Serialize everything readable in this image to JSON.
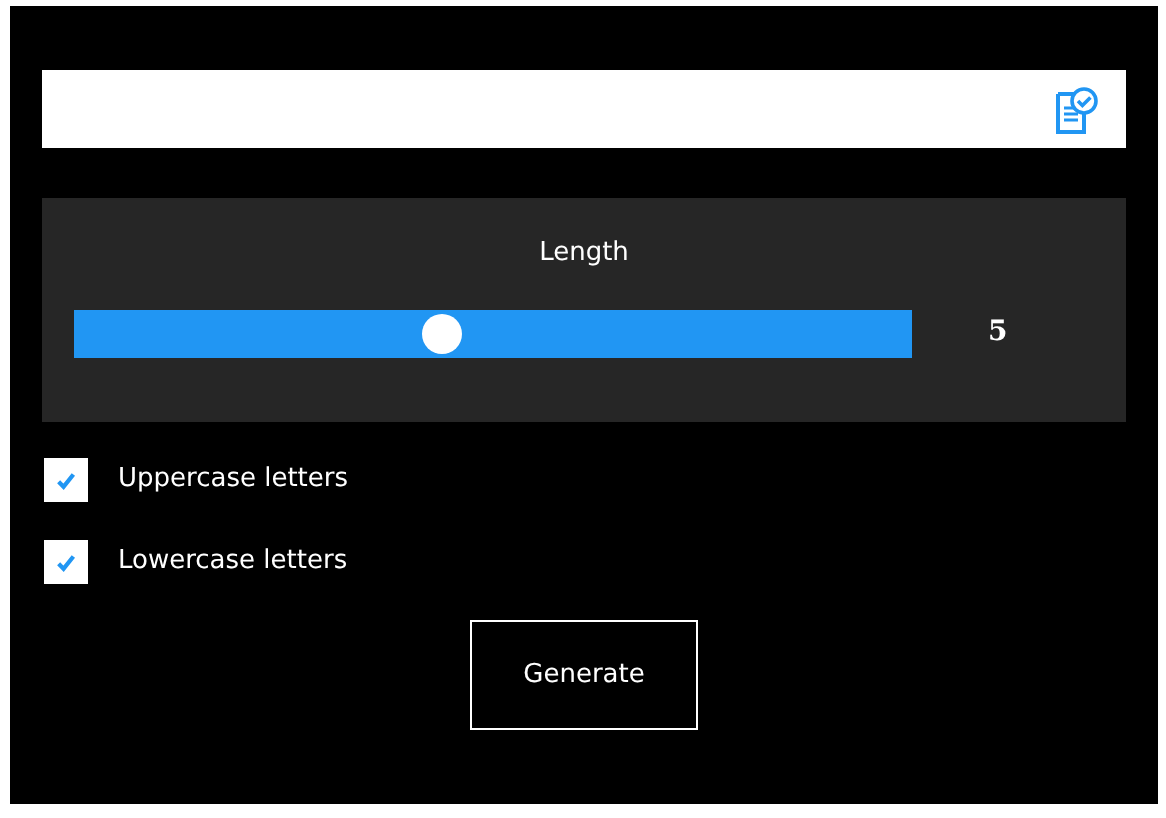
{
  "length": {
    "label": "Length",
    "level": 0.44,
    "reading": "5"
  },
  "options": [
    {
      "label": "Uppercase letters",
      "checked": true
    },
    {
      "label": "Lowercase letters",
      "checked": true
    }
  ],
  "buttons": [
    "Generate"
  ]
}
